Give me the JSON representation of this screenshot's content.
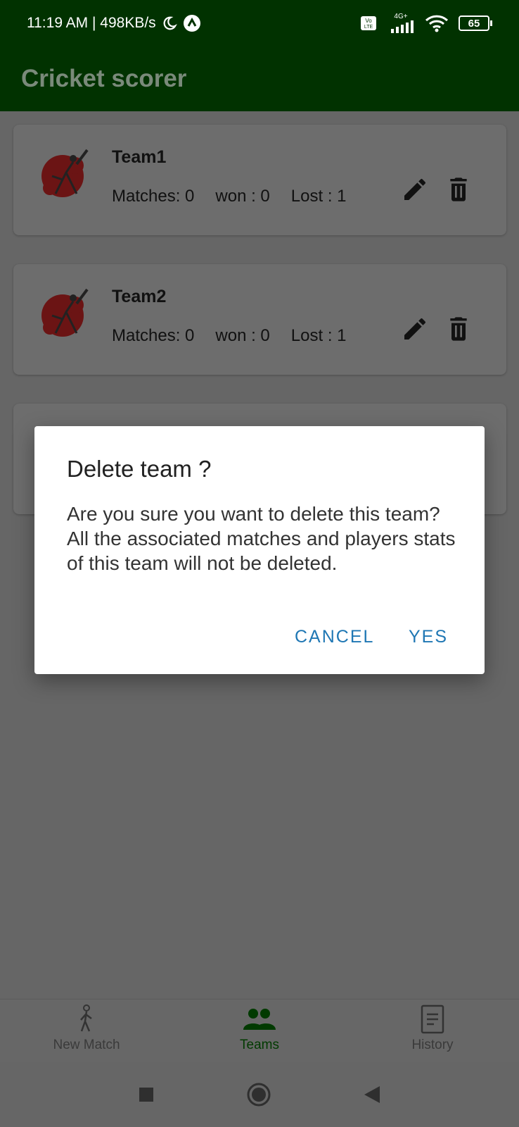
{
  "status_bar": {
    "time_speed": "11:19 AM | 498KB/s",
    "network": "4G+",
    "battery": "65",
    "icons": [
      "moon-icon",
      "app-notification-icon",
      "volte-icon",
      "signal-icon",
      "wifi-icon",
      "battery-icon"
    ]
  },
  "app_bar": {
    "title": "Cricket scorer"
  },
  "teams": [
    {
      "name": "Team1",
      "matches": "Matches: 0",
      "won": "won : 0",
      "lost": "Lost : 1"
    },
    {
      "name": "Team2",
      "matches": "Matches: 0",
      "won": "won : 0",
      "lost": "Lost : 1"
    }
  ],
  "dialog": {
    "title": "Delete team ?",
    "message": "Are you sure you want to delete this team?   All the associated matches and players stats of this team will not be deleted.",
    "cancel_label": "CANCEL",
    "yes_label": "YES"
  },
  "bottom_nav": {
    "items": [
      {
        "label": "New Match",
        "icon": "walking-person-icon"
      },
      {
        "label": "Teams",
        "icon": "people-icon",
        "active": true
      },
      {
        "label": "History",
        "icon": "document-icon"
      }
    ]
  },
  "colors": {
    "app_bar": "#013200",
    "accent_button": "#1f77b4",
    "active_nav": "#013a00"
  }
}
